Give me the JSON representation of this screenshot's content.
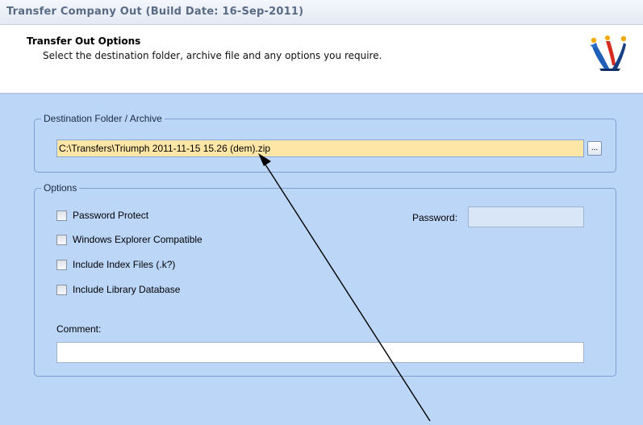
{
  "window": {
    "title": "Transfer Company Out (Build Date: 16-Sep-2011)"
  },
  "header": {
    "title": "Transfer Out Options",
    "subtitle": "Select the destination folder, archive file and any options you require.",
    "logo_icon": "celebrating-figures-logo"
  },
  "destination": {
    "legend": "Destination Folder / Archive",
    "path_value": "C:\\Transfers\\Triumph 2011-11-15 15.26 (dem).zip",
    "browse_label": "..."
  },
  "options": {
    "legend": "Options",
    "checkboxes": [
      {
        "label": "Password Protect",
        "checked": false
      },
      {
        "label": "Windows Explorer Compatible",
        "checked": false
      },
      {
        "label": "Include Index Files (.k?)",
        "checked": false
      },
      {
        "label": "Include Library Database",
        "checked": false
      }
    ],
    "password_label": "Password:",
    "password_value": "",
    "comment_label": "Comment:",
    "comment_value": ""
  },
  "colors": {
    "body_bg": "#bcd6f8",
    "path_input_bg": "#fde6a6",
    "group_border": "#7f9ecf"
  }
}
